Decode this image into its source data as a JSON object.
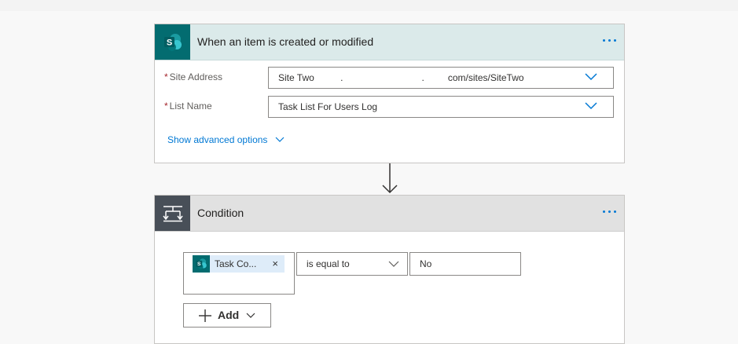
{
  "trigger": {
    "title": "When an item is created or modified",
    "icon": "sharepoint-icon",
    "site_address": {
      "label": "Site Address",
      "value": "Site Two          .                              .         com/sites/SiteTwo"
    },
    "list_name": {
      "label": "List Name",
      "value": "Task List For Users Log"
    },
    "advanced_link": "Show advanced options",
    "required_marker": "*"
  },
  "condition": {
    "title": "Condition",
    "icon": "condition-icon",
    "token": {
      "label": "Task Co...",
      "close": "×"
    },
    "operator": "is equal to",
    "value": "No",
    "add_button": "Add"
  },
  "colors": {
    "sharepoint_teal": "#036c70",
    "trigger_header": "#dbeaea",
    "condition_header": "#e1e1e1",
    "condition_icon_bg": "#484f58",
    "accent": "#0078d4",
    "required": "#a4262c"
  }
}
